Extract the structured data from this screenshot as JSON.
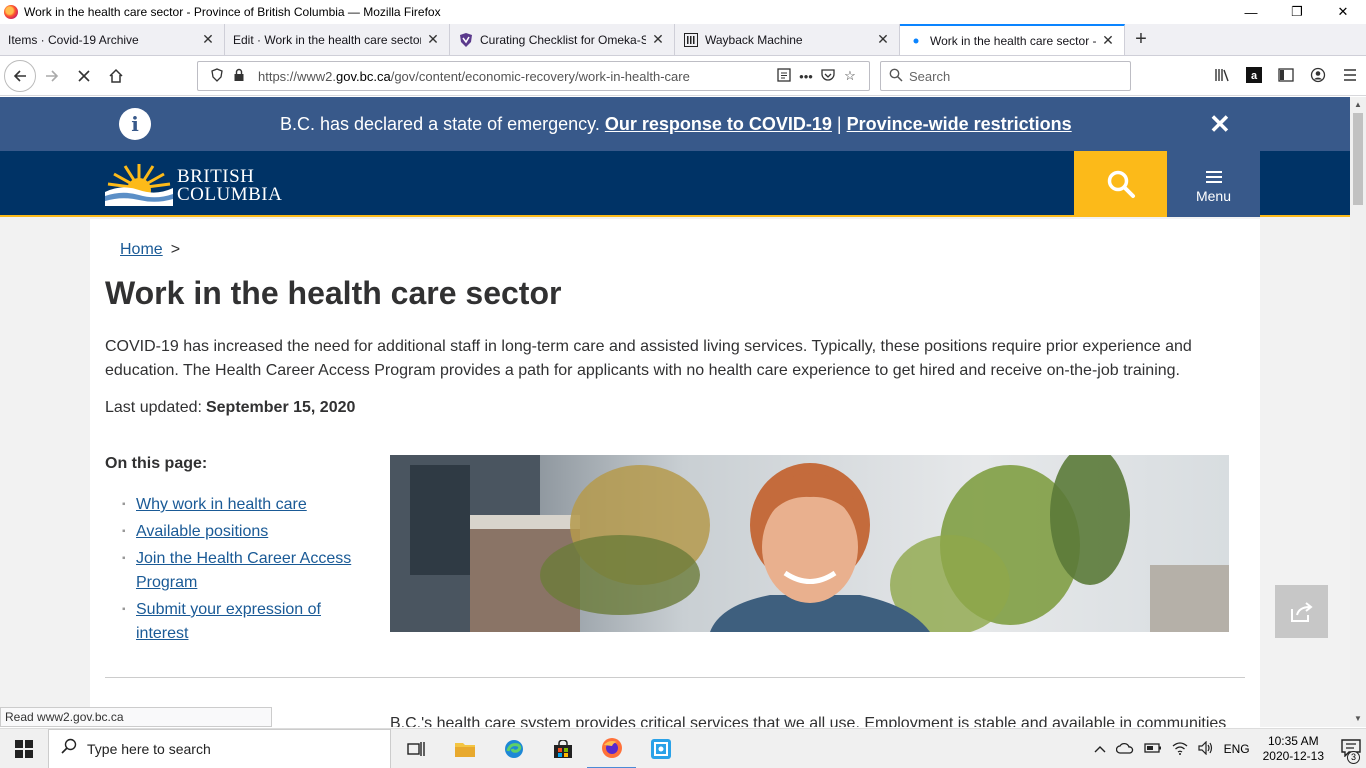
{
  "window": {
    "title": "Work in the health care sector - Province of British Columbia — Mozilla Firefox",
    "controls": {
      "minimize": "—",
      "restore": "❐",
      "close": "✕"
    }
  },
  "tabs": [
    {
      "label": "Items · Covid-19 Archive",
      "active": false,
      "icon": "none"
    },
    {
      "label": "Edit · Work in the health care sector",
      "active": false,
      "icon": "none"
    },
    {
      "label": "Curating Checklist for Omeka-S",
      "active": false,
      "icon": "shield-icon"
    },
    {
      "label": "Wayback Machine",
      "active": false,
      "icon": "archive-icon"
    },
    {
      "label": "Work in the health care sector - Pr",
      "active": true,
      "icon": "loading-dot-icon"
    }
  ],
  "newtab_label": "+",
  "navbar": {
    "url_prefix": "https://www2.",
    "url_domain": "gov.bc.ca",
    "url_path": "/gov/content/economic-recovery/work-in-health-care",
    "search_placeholder": "Search"
  },
  "alert": {
    "text": "B.C. has declared a state of emergency. ",
    "link1": "Our response to COVID-19",
    "separator": " | ",
    "link2": "Province-wide restrictions",
    "close": "✕",
    "info": "i"
  },
  "header": {
    "logo_line1": "BRITISH",
    "logo_line2": "COLUMBIA",
    "menu_label": "Menu",
    "colors": {
      "navy": "#003366",
      "gold": "#fcba19",
      "alert_blue": "#38598a"
    }
  },
  "breadcrumb": {
    "home": "Home",
    "sep": ">"
  },
  "page": {
    "title": "Work in the health care sector",
    "intro": "COVID-19 has increased the need for additional staff in long-term care and assisted living services. Typically, these positions require prior experience and education. The Health Career Access Program provides a path for applicants with no health care experience to get hired and receive on-the-job training.",
    "updated_label": "Last updated:",
    "updated_date": "September 15, 2020",
    "on_this_page": "On this page:",
    "toc": [
      "Why work in health care",
      "Available positions",
      "Join the Health Career Access Program",
      "Submit your expression of interest"
    ],
    "body_start": "B.C.'s health care system provides critical services that we all use. Employment is stable and available in communities"
  },
  "statusbar": "Read www2.gov.bc.ca",
  "taskbar": {
    "search_placeholder": "Type here to search",
    "lang": "ENG",
    "time": "10:35 AM",
    "date": "2020-12-13",
    "notifications": "3"
  }
}
